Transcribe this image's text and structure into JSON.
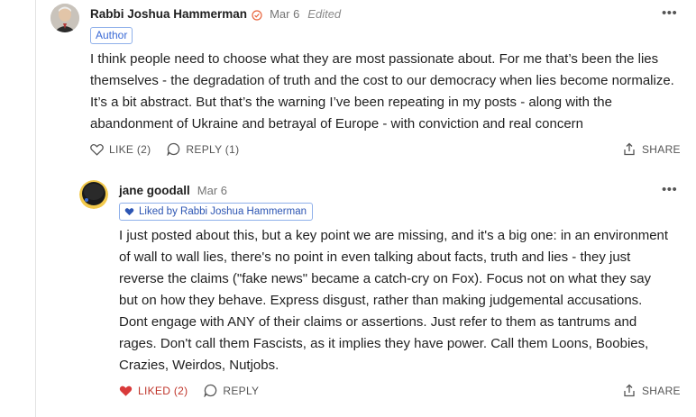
{
  "comment1": {
    "author": "Rabbi Joshua Hammerman",
    "date": "Mar 6",
    "edited": "Edited",
    "badge": "Author",
    "text": "I think people need to choose what they are most passionate about. For me that’s been the lies themselves - the degradation of truth and the cost to our democracy when lies become normalize. It’s a bit abstract. But that’s the warning I’ve been repeating in my posts - along with the abandonment of Ukraine and betrayal of Europe - with conviction and real concern",
    "like_label": "LIKE (2)",
    "reply_label": "REPLY (1)",
    "share_label": "SHARE",
    "more": "•••"
  },
  "comment2": {
    "author": "jane goodall",
    "date": "Mar 6",
    "liked_by": "Liked by Rabbi Joshua Hammerman",
    "text": "I just posted about this, but a key point we are missing, and it's a big one: in an environment of wall to wall lies, there's no point in even talking about facts, truth and lies - they just reverse the claims (\"fake news\" became a catch-cry on Fox). Focus not on what they say but on how they behave. Express disgust, rather than making judgemental accusations. Dont engage with ANY of their claims or assertions. Just refer to them as tantrums and rages. Don't call them Fascists, as it implies they have power. Call them Loons, Boobies, Crazies, Weirdos, Nutjobs.",
    "like_label": "LIKED (2)",
    "reply_label": "REPLY",
    "share_label": "SHARE",
    "more": "•••"
  },
  "colors": {
    "accent_blue": "#3b6bd6",
    "liked_red": "#d93a3a",
    "verified_orange": "#e8643c"
  },
  "icons": [
    "verified-icon",
    "more-icon",
    "heart-icon",
    "reply-icon",
    "share-icon",
    "heart-filled-icon"
  ]
}
